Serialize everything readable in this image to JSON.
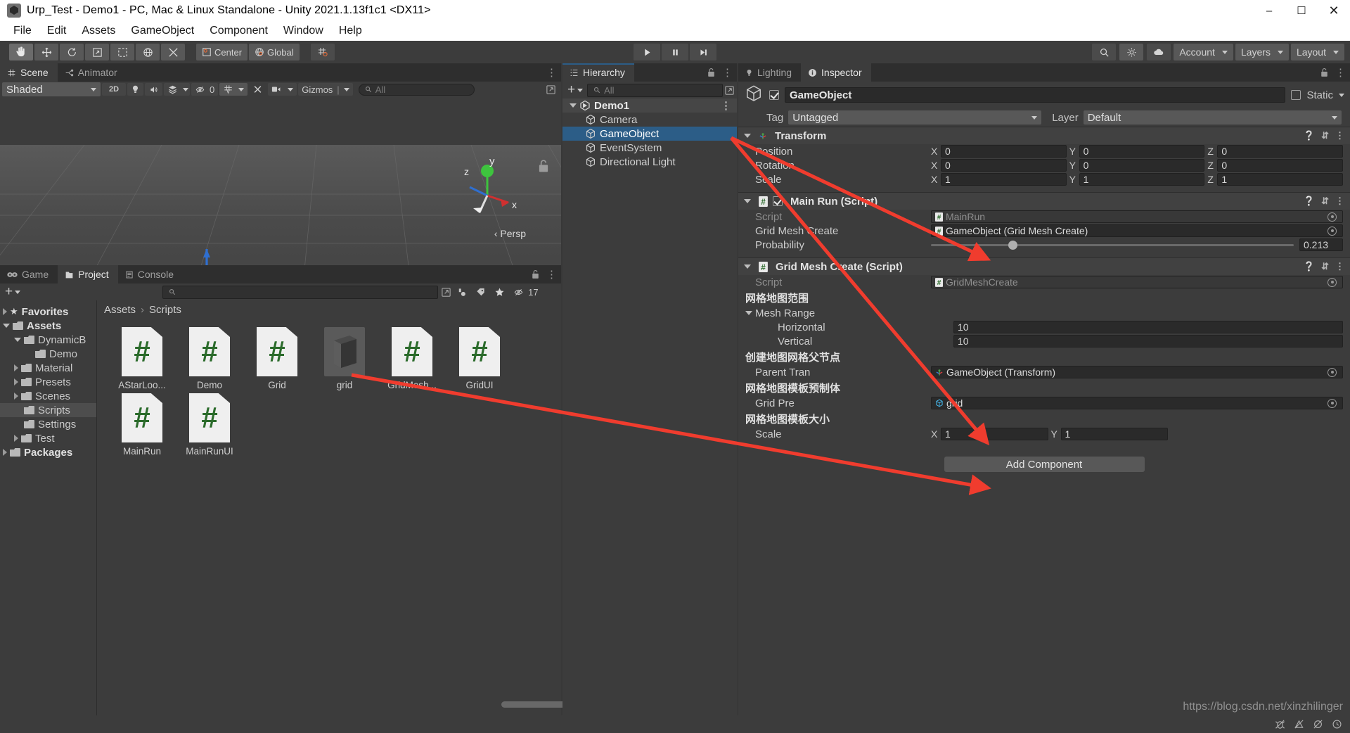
{
  "window": {
    "title": "Urp_Test - Demo1 - PC, Mac & Linux Standalone - Unity 2021.1.13f1c1 <DX11>",
    "app_icon": "unity-icon",
    "minimize": "–",
    "maximize": "☐",
    "close": "✕"
  },
  "menu": {
    "items": [
      "File",
      "Edit",
      "Assets",
      "GameObject",
      "Component",
      "Window",
      "Help"
    ]
  },
  "toolbar": {
    "tools": [
      {
        "name": "hand-tool",
        "icon": "hand-icon",
        "active": true
      },
      {
        "name": "move-tool",
        "icon": "move-icon",
        "active": false
      },
      {
        "name": "rotate-tool",
        "icon": "rotate-icon",
        "active": false
      },
      {
        "name": "scale-tool",
        "icon": "scale-icon",
        "active": false
      },
      {
        "name": "rect-tool",
        "icon": "rect-icon",
        "active": false
      },
      {
        "name": "transform-tool",
        "icon": "transform-icon",
        "active": false
      },
      {
        "name": "custom-tool",
        "icon": "wrench-icon",
        "active": false
      }
    ],
    "pivot_label": "Center",
    "space_label": "Global",
    "snap_icon": "grid-snap-icon",
    "play": "▶",
    "pause": "‖",
    "step": "▶|",
    "search_icon": "search-icon",
    "collab_icon": "collab-icon",
    "cloud_icon": "cloud-icon",
    "account_label": "Account",
    "layers_label": "Layers",
    "layout_label": "Layout"
  },
  "scene_panel": {
    "tabs": [
      {
        "label": "Scene",
        "icon": "scene-icon",
        "active": true
      },
      {
        "label": "Animator",
        "icon": "animator-icon",
        "active": false
      }
    ],
    "shading_mode": "Shaded",
    "mode_2d": "2D",
    "light_icon": "lighting-toggle-icon",
    "audio_icon": "audio-toggle-icon",
    "fx_icon": "effects-icon",
    "hidden_count": "0",
    "grid_icon": "grid-visibility-icon",
    "tools_icon": "scene-tools-icon",
    "camera_icon": "scene-camera-icon",
    "gizmos_label": "Gizmos",
    "search_placeholder": "All",
    "axis_labels": {
      "x": "x",
      "y": "y",
      "z": "z"
    },
    "persp_label": "‹ Persp"
  },
  "hierarchy": {
    "tab_label": "Hierarchy",
    "tab_icon": "hierarchy-icon",
    "lock_icon": "lock-icon",
    "menu_icon": "kebab-menu-icon",
    "add_label": "+",
    "search_placeholder": "All",
    "items": [
      {
        "label": "Demo1",
        "depth": 0,
        "type": "scene",
        "selected": false,
        "expanded": true
      },
      {
        "label": "Camera",
        "depth": 1,
        "type": "gameobject",
        "selected": false
      },
      {
        "label": "GameObject",
        "depth": 1,
        "type": "gameobject",
        "selected": true
      },
      {
        "label": "EventSystem",
        "depth": 1,
        "type": "gameobject",
        "selected": false
      },
      {
        "label": "Directional Light",
        "depth": 1,
        "type": "gameobject",
        "selected": false
      }
    ]
  },
  "inspector": {
    "tabs": [
      {
        "label": "Lighting",
        "icon": "lighting-icon",
        "active": false
      },
      {
        "label": "Inspector",
        "icon": "info-icon",
        "active": true
      }
    ],
    "lock_icon": "lock-icon",
    "menu_icon": "kebab-menu-icon",
    "object_icon": "gameobject-cube-icon",
    "enabled": true,
    "name": "GameObject",
    "static_label": "Static",
    "static_checked": false,
    "tag_label": "Tag",
    "tag_value": "Untagged",
    "layer_label": "Layer",
    "layer_value": "Default",
    "components": [
      {
        "title": "Transform",
        "icon": "transform-icon",
        "has_toggle": false,
        "rows": [
          {
            "label": "Position",
            "type": "vector3",
            "values": [
              "0",
              "0",
              "0"
            ]
          },
          {
            "label": "Rotation",
            "type": "vector3",
            "values": [
              "0",
              "0",
              "0"
            ]
          },
          {
            "label": "Scale",
            "type": "vector3",
            "values": [
              "1",
              "1",
              "1"
            ]
          }
        ]
      },
      {
        "title": "Main Run (Script)",
        "icon": "script-icon",
        "has_toggle": true,
        "enabled": true,
        "rows": [
          {
            "label": "Script",
            "type": "object",
            "value": "MainRun",
            "readonly": true,
            "obj_icon": "script-icon"
          },
          {
            "label": "Grid Mesh Create",
            "type": "object",
            "value": "GameObject (Grid Mesh Create)",
            "readonly": false,
            "obj_icon": "script-icon"
          },
          {
            "label": "Probability",
            "type": "slider",
            "value": "0.213",
            "fraction": 0.213
          }
        ]
      },
      {
        "title": "Grid Mesh Create (Script)",
        "icon": "script-icon",
        "has_toggle": false,
        "rows": [
          {
            "label": "Script",
            "type": "object",
            "value": "GridMeshCreate",
            "readonly": true,
            "obj_icon": "script-icon"
          },
          {
            "label": "网格地图范围",
            "type": "header_cn"
          },
          {
            "label": "Mesh Range",
            "type": "foldout"
          },
          {
            "label": "Horizontal",
            "type": "text",
            "value": "10",
            "indent": 2
          },
          {
            "label": "Vertical",
            "type": "text",
            "value": "10",
            "indent": 2
          },
          {
            "label": "创建地图网格父节点",
            "type": "header_cn"
          },
          {
            "label": "Parent Tran",
            "type": "object",
            "value": "GameObject (Transform)",
            "readonly": false,
            "obj_icon": "transform-icon"
          },
          {
            "label": "网格地图模板预制体",
            "type": "header_cn"
          },
          {
            "label": "Grid Pre",
            "type": "object",
            "value": "grid",
            "readonly": false,
            "obj_icon": "prefab-icon"
          },
          {
            "label": "网格地图模板大小",
            "type": "header_cn"
          },
          {
            "label": "Scale",
            "type": "vector2",
            "values": [
              "1",
              "1"
            ]
          }
        ]
      }
    ],
    "add_component_label": "Add Component"
  },
  "project": {
    "tabs": [
      {
        "label": "Game",
        "icon": "game-icon",
        "active": false
      },
      {
        "label": "Project",
        "icon": "project-icon",
        "active": true
      },
      {
        "label": "Console",
        "icon": "console-icon",
        "active": false
      }
    ],
    "lock_icon": "lock-icon",
    "menu_icon": "kebab-menu-icon",
    "add_label": "+",
    "search_placeholder": "",
    "filter_icons": [
      "type-filter-icon",
      "label-filter-icon",
      "favorite-filter-icon"
    ],
    "hidden_count": "17",
    "breadcrumb": [
      "Assets",
      "Scripts"
    ],
    "tree": [
      {
        "label": "Favorites",
        "depth": 0,
        "icon": "star-icon",
        "arrow": "right",
        "bold": true
      },
      {
        "label": "Assets",
        "depth": 0,
        "icon": "folder-icon",
        "arrow": "down",
        "bold": true
      },
      {
        "label": "DynamicB",
        "depth": 1,
        "icon": "folder-icon",
        "arrow": "down",
        "bold": false
      },
      {
        "label": "Demo",
        "depth": 2,
        "icon": "folder-icon",
        "arrow": "none",
        "bold": false
      },
      {
        "label": "Material",
        "depth": 1,
        "icon": "folder-icon",
        "arrow": "right",
        "bold": false
      },
      {
        "label": "Presets",
        "depth": 1,
        "icon": "folder-icon",
        "arrow": "right",
        "bold": false
      },
      {
        "label": "Scenes",
        "depth": 1,
        "icon": "folder-icon",
        "arrow": "right",
        "bold": false
      },
      {
        "label": "Scripts",
        "depth": 1,
        "icon": "folder-icon",
        "arrow": "none",
        "bold": false,
        "selected": true
      },
      {
        "label": "Settings",
        "depth": 1,
        "icon": "folder-icon",
        "arrow": "none",
        "bold": false
      },
      {
        "label": "Test",
        "depth": 1,
        "icon": "folder-icon",
        "arrow": "right",
        "bold": false
      },
      {
        "label": "Packages",
        "depth": 0,
        "icon": "folder-icon",
        "arrow": "right",
        "bold": true
      }
    ],
    "assets": [
      {
        "label": "AStarLoo...",
        "type": "script",
        "selected": false
      },
      {
        "label": "Demo",
        "type": "script",
        "selected": false
      },
      {
        "label": "Grid",
        "type": "script",
        "selected": false
      },
      {
        "label": "grid",
        "type": "prefab",
        "selected": true
      },
      {
        "label": "GridMesh...",
        "type": "script",
        "selected": false
      },
      {
        "label": "GridUI",
        "type": "script",
        "selected": false
      },
      {
        "label": "MainRun",
        "type": "script",
        "selected": false
      },
      {
        "label": "MainRunUI",
        "type": "script",
        "selected": false
      }
    ]
  },
  "status_bar": {
    "watermark": "https://blog.csdn.net/xinzhilinger",
    "icons": [
      "bug-mute-icon",
      "warning-mute-icon",
      "error-mute-icon",
      "clock-icon"
    ]
  },
  "colors": {
    "selection_blue": "#2c5d87",
    "arrow_red": "#f03c2e",
    "panel_bg": "#3c3c3c",
    "header_bg": "#414141",
    "script_green": "#2b6b2b"
  }
}
